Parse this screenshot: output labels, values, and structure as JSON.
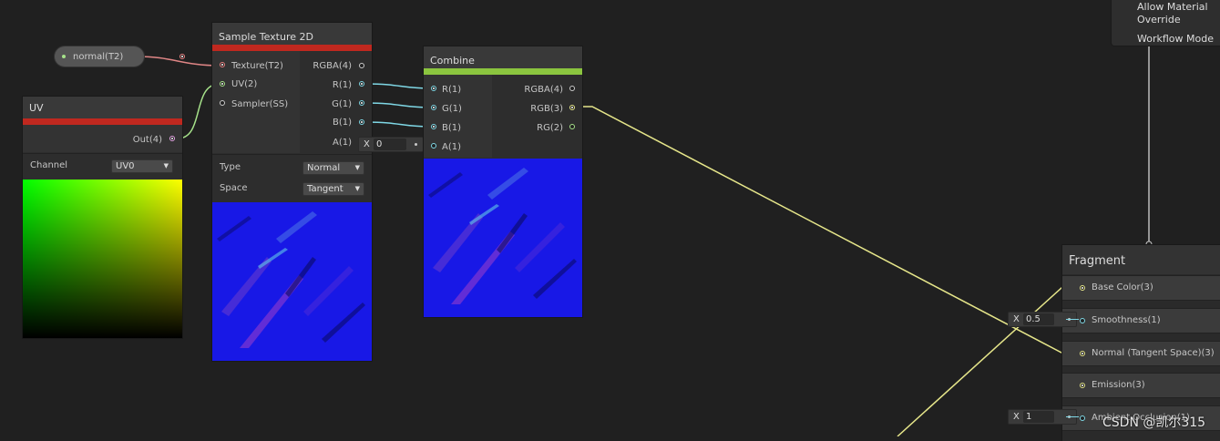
{
  "property_pill": {
    "label": "normal(T2)"
  },
  "sample_texture_node": {
    "title": "Sample Texture 2D",
    "inputs": [
      "Texture(T2)",
      "UV(2)",
      "Sampler(SS)"
    ],
    "outputs": [
      "RGBA(4)",
      "R(1)",
      "G(1)",
      "B(1)",
      "A(1)"
    ],
    "a_input": {
      "axis": "X",
      "value": "0"
    },
    "type_label": "Type",
    "type_value": "Normal",
    "space_label": "Space",
    "space_value": "Tangent"
  },
  "uv_node": {
    "title": "UV",
    "output": "Out(4)",
    "channel_label": "Channel",
    "channel_value": "UV0"
  },
  "combine_node": {
    "title": "Combine",
    "inputs": [
      "R(1)",
      "G(1)",
      "B(1)",
      "A(1)"
    ],
    "outputs": [
      "RGBA(4)",
      "RGB(3)",
      "RG(2)"
    ]
  },
  "graph_settings_panel": {
    "items": [
      "Allow Material",
      "Override",
      "Workflow Mode"
    ]
  },
  "fragment_node": {
    "title": "Fragment",
    "slots": [
      "Base Color(3)",
      "Smoothness(1)",
      "Normal (Tangent Space)(3)",
      "Emission(3)",
      "Ambient Occlusion(1)"
    ],
    "smoothness_input": {
      "axis": "X",
      "value": "0.5"
    },
    "occlusion_input": {
      "axis": "X",
      "value": "1"
    }
  },
  "watermark": "CSDN @凯尔315",
  "colors": {
    "texture_stripe": "#c0281f",
    "uv_stripe": "#c0281f",
    "combine_stripe": "#8bc53f",
    "vector3_wire": "#e8e88a",
    "vector1_wire": "#7fd8e6",
    "texture_wire": "#e88080",
    "vector2_wire": "#a6e28a"
  }
}
